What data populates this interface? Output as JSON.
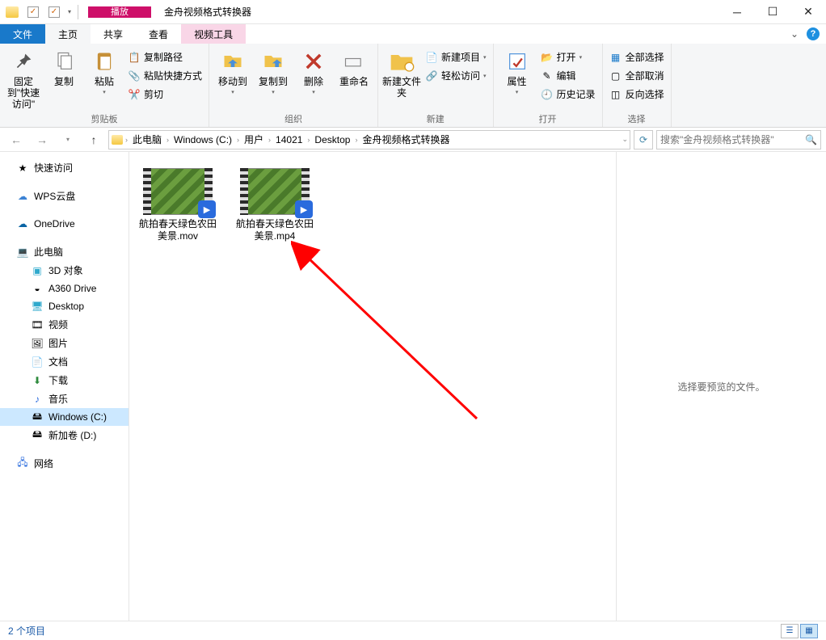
{
  "window": {
    "title": "金舟视频格式转换器",
    "context_tab_group": "播放",
    "context_tab": "视频工具"
  },
  "tabs": {
    "file": "文件",
    "home": "主页",
    "share": "共享",
    "view": "查看"
  },
  "ribbon": {
    "pin": "固定到\"快速访问\"",
    "copy": "复制",
    "paste": "粘贴",
    "copy_path": "复制路径",
    "paste_shortcut": "粘贴快捷方式",
    "cut": "剪切",
    "clipboard_group": "剪贴板",
    "move_to": "移动到",
    "copy_to": "复制到",
    "delete": "删除",
    "rename": "重命名",
    "organize_group": "组织",
    "new_folder": "新建文件夹",
    "new_item": "新建项目",
    "easy_access": "轻松访问",
    "new_group": "新建",
    "properties": "属性",
    "open": "打开",
    "edit": "编辑",
    "history": "历史记录",
    "open_group": "打开",
    "select_all": "全部选择",
    "select_none": "全部取消",
    "invert_selection": "反向选择",
    "select_group": "选择"
  },
  "breadcrumb": {
    "items": [
      "此电脑",
      "Windows (C:)",
      "用户",
      "14021",
      "Desktop",
      "金舟视频格式转换器"
    ]
  },
  "search": {
    "placeholder": "搜索\"金舟视频格式转换器\""
  },
  "nav": {
    "quick_access": "快速访问",
    "wps_cloud": "WPS云盘",
    "onedrive": "OneDrive",
    "this_pc": "此电脑",
    "objects_3d": "3D 对象",
    "a360": "A360 Drive",
    "desktop": "Desktop",
    "videos": "视频",
    "pictures": "图片",
    "documents": "文档",
    "downloads": "下载",
    "music": "音乐",
    "c_drive": "Windows (C:)",
    "d_drive": "新加卷 (D:)",
    "network": "网络"
  },
  "files": [
    {
      "name": "航拍春天绿色农田美景.mov"
    },
    {
      "name": "航拍春天绿色农田美景.mp4"
    }
  ],
  "preview": {
    "message": "选择要预览的文件。"
  },
  "status": {
    "count": "2 个项目"
  }
}
